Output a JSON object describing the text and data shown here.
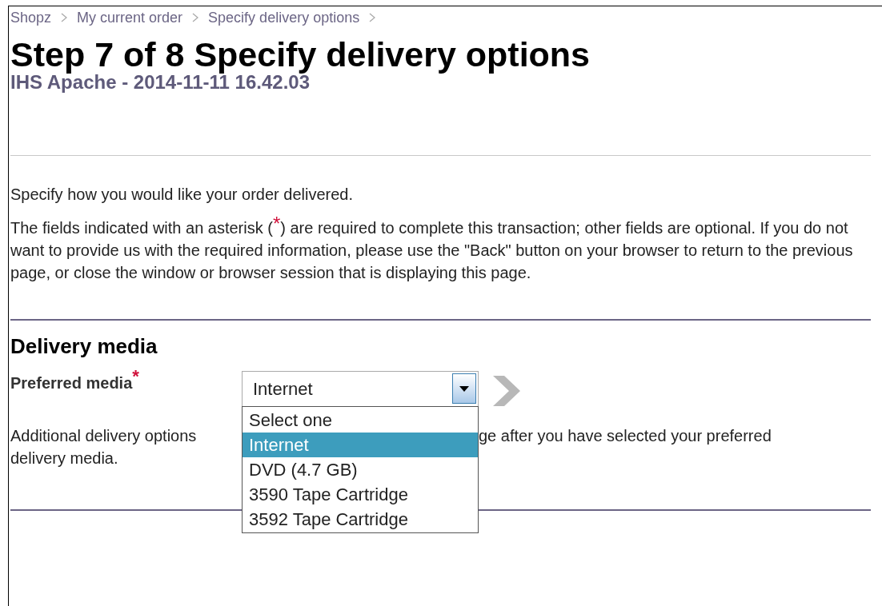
{
  "breadcrumb": [
    {
      "label": "Shopz"
    },
    {
      "label": "My current order"
    },
    {
      "label": "Specify delivery options"
    }
  ],
  "title": "Step 7 of 8 Specify delivery options",
  "subtitle": "IHS Apache - 2014-11-11 16.42.03",
  "intro": "Specify how you would like your order delivered.",
  "required_note": {
    "before": "The fields indicated with an asterisk (",
    "mark": "*",
    "after": ") are required to complete this transaction; other fields are optional. If you do not want to provide us with the required information, please use the \"Back\" button on your browser to return to the previous page, or close the window or browser session that is displaying this page."
  },
  "section": {
    "heading": "Delivery media",
    "field": {
      "label": "Preferred media",
      "required": true,
      "value": "Internet",
      "expanded": true,
      "options": [
        {
          "label": "Select one",
          "selected": false
        },
        {
          "label": "Internet",
          "selected": true
        },
        {
          "label": "DVD (4.7 GB)",
          "selected": false
        },
        {
          "label": "3590 Tape Cartridge",
          "selected": false
        },
        {
          "label": "3592 Tape Cartridge",
          "selected": false
        }
      ]
    },
    "note_left": "Additional delivery options",
    "note_right": "ge after you have selected your preferred",
    "note_line2": "delivery media."
  }
}
